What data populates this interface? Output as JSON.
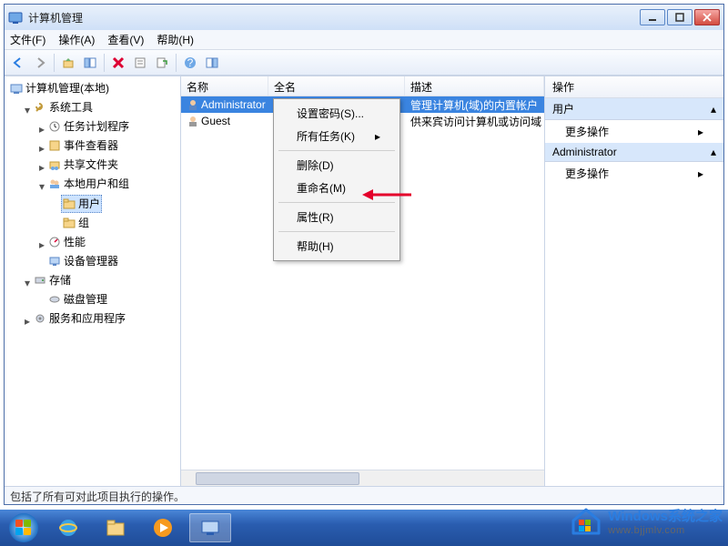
{
  "window": {
    "title": "计算机管理"
  },
  "menus": {
    "file": "文件(F)",
    "action": "操作(A)",
    "view": "查看(V)",
    "help": "帮助(H)"
  },
  "tree": {
    "root": "计算机管理(本地)",
    "system_tools": "系统工具",
    "task_scheduler": "任务计划程序",
    "event_viewer": "事件查看器",
    "shared_folders": "共享文件夹",
    "local_users": "本地用户和组",
    "users": "用户",
    "groups": "组",
    "performance": "性能",
    "device_manager": "设备管理器",
    "storage": "存储",
    "disk_management": "磁盘管理",
    "services_apps": "服务和应用程序"
  },
  "list": {
    "columns": {
      "name": "名称",
      "fullname": "全名",
      "desc": "描述"
    },
    "rows": [
      {
        "name": "Administrator",
        "fullname": "",
        "desc": "管理计算机(域)的内置帐户",
        "selected": true
      },
      {
        "name": "Guest",
        "fullname": "",
        "desc": "供来宾访问计算机或访问域",
        "selected": false
      }
    ]
  },
  "actions": {
    "title": "操作",
    "section_user": "用户",
    "more_actions": "更多操作",
    "section_admin": "Administrator"
  },
  "context_menu": {
    "set_password": "设置密码(S)...",
    "all_tasks": "所有任务(K)",
    "delete": "删除(D)",
    "rename": "重命名(M)",
    "properties": "属性(R)",
    "help": "帮助(H)"
  },
  "statusbar": "包括了所有可对此项目执行的操作。",
  "watermark": {
    "line1": "Windows系统之家",
    "line2": "www.bjjmlv.com"
  }
}
